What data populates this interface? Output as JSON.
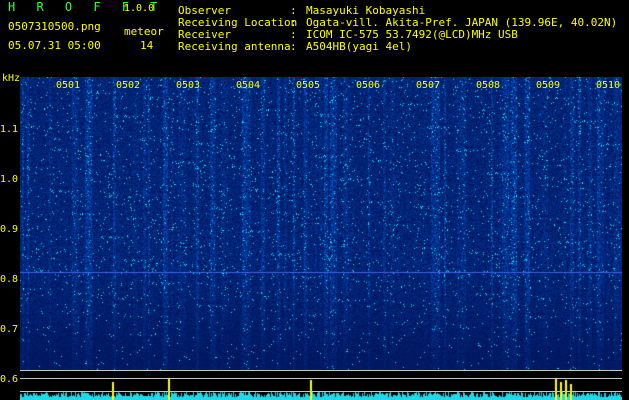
{
  "header": {
    "title": "H R O F F T",
    "version": "1.0.0",
    "file_name": "0507310500.png",
    "datetime": "05.07.31 05:00",
    "meteor_label": "meteor",
    "meteor_count": "14",
    "meta": [
      {
        "label": "Observer",
        "value": "Masayuki Kobayashi"
      },
      {
        "label": "Receiving Location",
        "value": "Ogata-vill. Akita-Pref. JAPAN (139.96E, 40.02N)"
      },
      {
        "label": "Receiver",
        "value": "ICOM IC-575 53.7492(@LCD)MHz USB"
      },
      {
        "label": "Receiving antenna",
        "value": "A504HB(yagi 4el)"
      }
    ]
  },
  "spectrogram": {
    "y_unit": "kHz",
    "y_ticks": [
      "1.1",
      "1.0",
      "0.9",
      "0.8",
      "0.7",
      "0.6"
    ],
    "x_ticks": [
      "0501",
      "0502",
      "0503",
      "0504",
      "0505",
      "0506",
      "0507",
      "0508",
      "0509",
      "0510"
    ],
    "colors": {
      "background": "#000000",
      "text": "#ffff00",
      "signal_low": "#00148c",
      "signal_high": "#00ffff",
      "meteor_bar": "#ffff00"
    }
  }
}
